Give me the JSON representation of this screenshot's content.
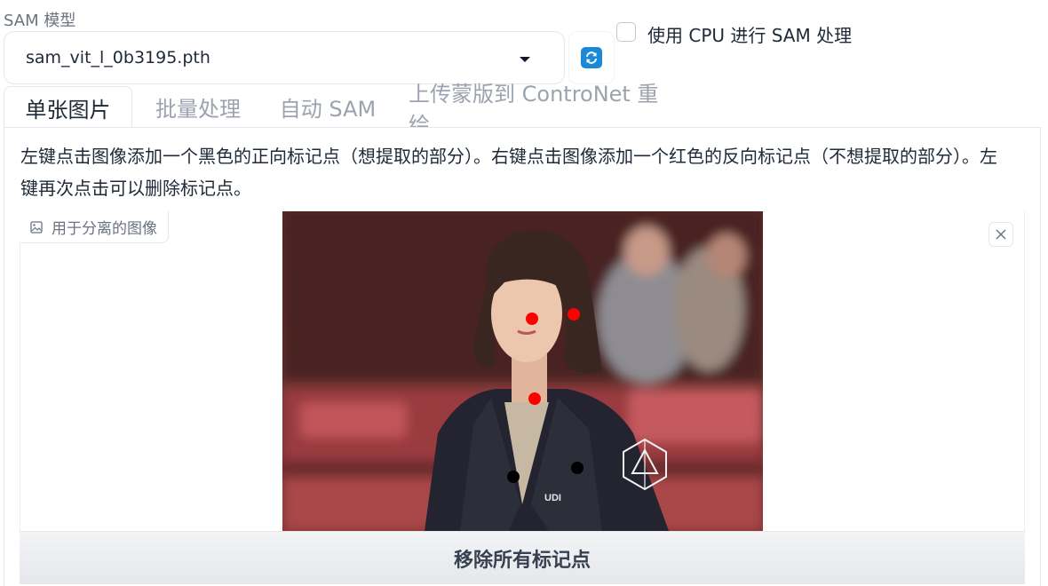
{
  "model": {
    "label": "SAM 模型",
    "selected": "sam_vit_l_0b3195.pth",
    "dropdown_icon": "chevron-down-icon",
    "refresh_icon": "refresh-icon",
    "refresh_color": "#1a8ad8"
  },
  "cpu_option": {
    "label": "使用 CPU 进行 SAM 处理",
    "checked": false
  },
  "tabs": [
    {
      "label": "单张图片",
      "active": true
    },
    {
      "label": "批量处理",
      "active": false
    },
    {
      "label": "自动 SAM",
      "active": false
    },
    {
      "label": "上传蒙版到 ControNet 重绘",
      "active": false
    }
  ],
  "instructions": "左键点击图像添加一个黑色的正向标记点（想提取的部分）。右键点击图像添加一个红色的反向标记点（不想提取的部分）。左键再次点击可以删除标记点。",
  "image_panel": {
    "label": "用于分离的图像",
    "label_icon": "image-icon",
    "clear_icon": "close-icon",
    "markers": [
      {
        "type": "negative",
        "color": "#ff0000"
      },
      {
        "type": "negative",
        "color": "#ff0000"
      },
      {
        "type": "negative",
        "color": "#ff0000"
      },
      {
        "type": "positive",
        "color": "#000000"
      },
      {
        "type": "positive",
        "color": "#000000"
      }
    ],
    "jacket_logo_text": "UDI"
  },
  "remove_button": {
    "label": "移除所有标记点"
  }
}
